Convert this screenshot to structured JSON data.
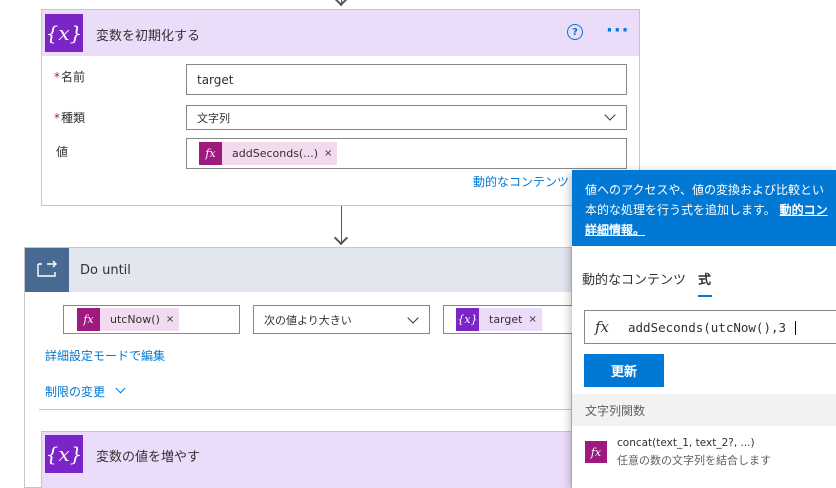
{
  "init_card": {
    "title": "変数を初期化する",
    "icon": "{x}",
    "help_icon": "?",
    "menu_dots": "···",
    "name_label": "名前",
    "name_value": "target",
    "type_label": "種類",
    "type_value": "文字列",
    "value_label": "値",
    "value_token": "addSeconds(...)",
    "dynamic_link": "動的なコンテンツ",
    "required_mark": "*"
  },
  "do_until": {
    "title": "Do until",
    "left_token": "utcNow()",
    "operator": "次の値より大きい",
    "right_token": "target",
    "advanced_link": "詳細設定モードで編集",
    "limits_link": "制限の変更"
  },
  "increment_card": {
    "title": "変数の値を増やす",
    "icon": "{x}"
  },
  "popup": {
    "banner_line1": "値へのアクセスや、値の変換および比較とい",
    "banner_line2_text": "本的な処理を行う式を追加します。",
    "banner_line2_link": "動的コン",
    "banner_line3_link": "詳細情報。",
    "tab_dynamic": "動的なコンテンツ",
    "tab_expression": "式",
    "fx": "fx",
    "expression": "addSeconds(utcNow(),3)",
    "update_button": "更新",
    "section_title": "文字列関数",
    "function_name": "concat(text_1, text_2?, ...)",
    "function_desc": "任意の数の文字列を結合します"
  },
  "token_remove": "×",
  "colors": {
    "variable_purple": "#7b24c8",
    "expression_magenta": "#9e1a7f",
    "loop_blue": "#486991",
    "accent_blue": "#0078d4"
  }
}
